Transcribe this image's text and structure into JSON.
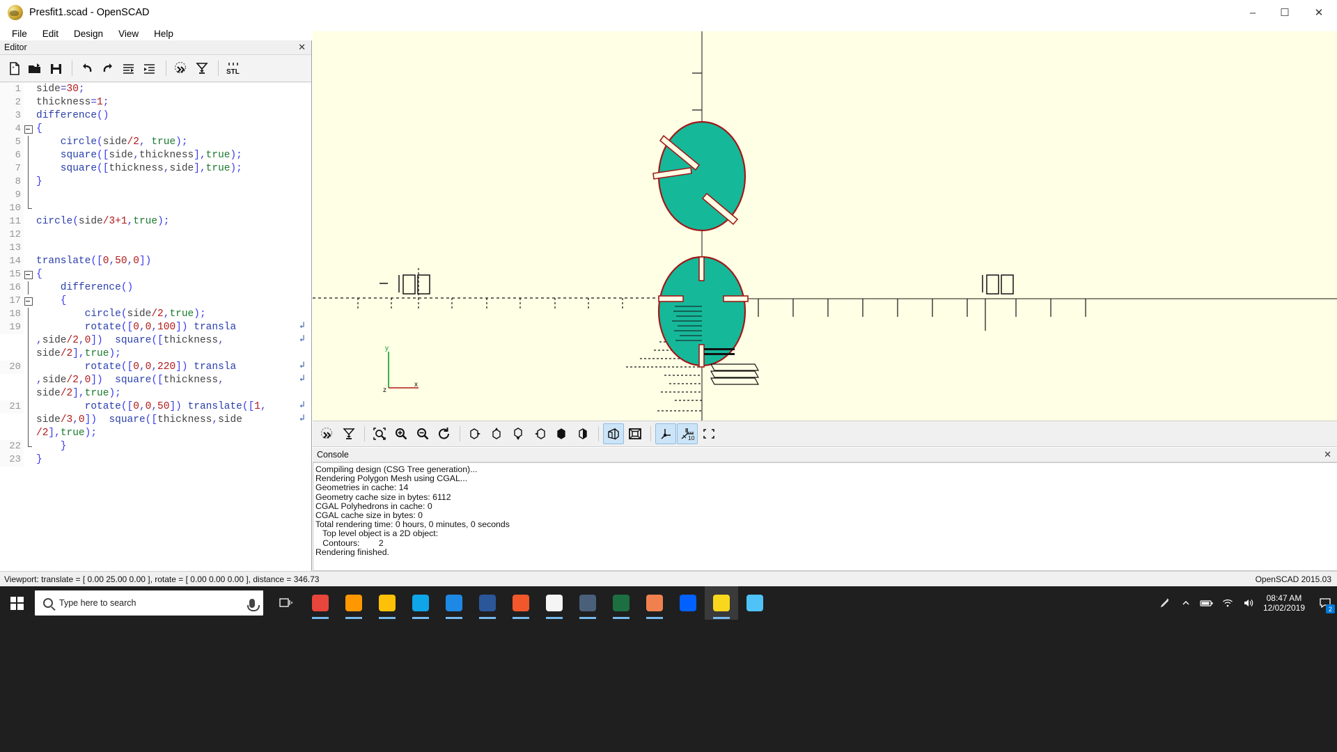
{
  "window": {
    "title": "Presfit1.scad - OpenSCAD",
    "app_icon": "openscad-logo-icon",
    "minimize": "–",
    "maximize": "☐",
    "close": "✕"
  },
  "menubar": {
    "items": [
      {
        "label": "File"
      },
      {
        "label": "Edit"
      },
      {
        "label": "Design"
      },
      {
        "label": "View"
      },
      {
        "label": "Help"
      }
    ]
  },
  "editor": {
    "dock_title": "Editor",
    "close_label": "✕",
    "toolbar": [
      {
        "name": "new-file-button",
        "tip": "New"
      },
      {
        "name": "open-file-button",
        "tip": "Open"
      },
      {
        "name": "save-file-button",
        "tip": "Save"
      },
      {
        "name": "undo-button",
        "tip": "Undo"
      },
      {
        "name": "redo-button",
        "tip": "Redo"
      },
      {
        "name": "unindent-button",
        "tip": "Unindent"
      },
      {
        "name": "indent-button",
        "tip": "Indent"
      },
      {
        "name": "preview-button",
        "tip": "Preview"
      },
      {
        "name": "render-button",
        "tip": "Render"
      },
      {
        "name": "export-stl-button",
        "tip": "Export as STL",
        "label": "STL"
      }
    ],
    "lines": [
      {
        "n": "1",
        "fold": "none",
        "segs": [
          {
            "t": "side",
            "c": "var"
          },
          {
            "t": "=",
            "c": "pun"
          },
          {
            "t": "30",
            "c": "num"
          },
          {
            "t": ";",
            "c": "pun"
          }
        ]
      },
      {
        "n": "2",
        "fold": "none",
        "segs": [
          {
            "t": "thickness",
            "c": "var"
          },
          {
            "t": "=",
            "c": "pun"
          },
          {
            "t": "1",
            "c": "num"
          },
          {
            "t": ";",
            "c": "pun"
          }
        ]
      },
      {
        "n": "3",
        "fold": "none",
        "segs": [
          {
            "t": "difference",
            "c": "kw"
          },
          {
            "t": "()",
            "c": "op"
          }
        ]
      },
      {
        "n": "4",
        "fold": "box",
        "segs": [
          {
            "t": "{",
            "c": "op"
          }
        ]
      },
      {
        "n": "5",
        "fold": "bar",
        "segs": [
          {
            "t": "    circle",
            "c": "kw"
          },
          {
            "t": "(",
            "c": "op"
          },
          {
            "t": "side",
            "c": "var"
          },
          {
            "t": "/",
            "c": "num"
          },
          {
            "t": "2",
            "c": "num"
          },
          {
            "t": ", ",
            "c": "pun"
          },
          {
            "t": "true",
            "c": "bool"
          },
          {
            "t": ");",
            "c": "op"
          }
        ]
      },
      {
        "n": "6",
        "fold": "bar",
        "segs": [
          {
            "t": "    square",
            "c": "kw"
          },
          {
            "t": "([",
            "c": "op"
          },
          {
            "t": "side",
            "c": "var"
          },
          {
            "t": ",",
            "c": "pun"
          },
          {
            "t": "thickness",
            "c": "var"
          },
          {
            "t": "],",
            "c": "op"
          },
          {
            "t": "true",
            "c": "bool"
          },
          {
            "t": ");",
            "c": "op"
          }
        ]
      },
      {
        "n": "7",
        "fold": "bar",
        "segs": [
          {
            "t": "    square",
            "c": "kw"
          },
          {
            "t": "([",
            "c": "op"
          },
          {
            "t": "thickness",
            "c": "var"
          },
          {
            "t": ",",
            "c": "pun"
          },
          {
            "t": "side",
            "c": "var"
          },
          {
            "t": "],",
            "c": "op"
          },
          {
            "t": "true",
            "c": "bool"
          },
          {
            "t": ");",
            "c": "op"
          }
        ]
      },
      {
        "n": "8",
        "fold": "bar",
        "segs": [
          {
            "t": "}",
            "c": "op"
          }
        ]
      },
      {
        "n": "9",
        "fold": "bar",
        "segs": []
      },
      {
        "n": "10",
        "fold": "endbar",
        "segs": []
      },
      {
        "n": "11",
        "fold": "none",
        "segs": [
          {
            "t": "circle",
            "c": "kw"
          },
          {
            "t": "(",
            "c": "op"
          },
          {
            "t": "side",
            "c": "var"
          },
          {
            "t": "/",
            "c": "num"
          },
          {
            "t": "3",
            "c": "num"
          },
          {
            "t": "+",
            "c": "num"
          },
          {
            "t": "1",
            "c": "num"
          },
          {
            "t": ",",
            "c": "pun"
          },
          {
            "t": "true",
            "c": "bool"
          },
          {
            "t": ");",
            "c": "op"
          }
        ]
      },
      {
        "n": "12",
        "fold": "none",
        "segs": []
      },
      {
        "n": "13",
        "fold": "none",
        "segs": []
      },
      {
        "n": "14",
        "fold": "none",
        "segs": [
          {
            "t": "translate",
            "c": "kw"
          },
          {
            "t": "([",
            "c": "op"
          },
          {
            "t": "0",
            "c": "num"
          },
          {
            "t": ",",
            "c": "pun"
          },
          {
            "t": "50",
            "c": "num"
          },
          {
            "t": ",",
            "c": "pun"
          },
          {
            "t": "0",
            "c": "num"
          },
          {
            "t": "])",
            "c": "op"
          }
        ]
      },
      {
        "n": "15",
        "fold": "box",
        "segs": [
          {
            "t": "{",
            "c": "op"
          }
        ]
      },
      {
        "n": "16",
        "fold": "bar",
        "segs": [
          {
            "t": "    difference",
            "c": "kw"
          },
          {
            "t": "()",
            "c": "op"
          }
        ]
      },
      {
        "n": "17",
        "fold": "box2",
        "segs": [
          {
            "t": "    {",
            "c": "op"
          }
        ]
      },
      {
        "n": "18",
        "fold": "bar",
        "segs": [
          {
            "t": "        circle",
            "c": "kw"
          },
          {
            "t": "(",
            "c": "op"
          },
          {
            "t": "side",
            "c": "var"
          },
          {
            "t": "/",
            "c": "num"
          },
          {
            "t": "2",
            "c": "num"
          },
          {
            "t": ",",
            "c": "pun"
          },
          {
            "t": "true",
            "c": "bool"
          },
          {
            "t": ");",
            "c": "op"
          }
        ]
      },
      {
        "n": "19",
        "fold": "bar",
        "wrap": true,
        "segs": [
          {
            "t": "        rotate",
            "c": "kw"
          },
          {
            "t": "([",
            "c": "op"
          },
          {
            "t": "0",
            "c": "num"
          },
          {
            "t": ",",
            "c": "pun"
          },
          {
            "t": "0",
            "c": "num"
          },
          {
            "t": ",",
            "c": "pun"
          },
          {
            "t": "100",
            "c": "num"
          },
          {
            "t": "]) ",
            "c": "op"
          },
          {
            "t": "transla",
            "c": "kw"
          }
        ]
      },
      {
        "n": "",
        "fold": "bar",
        "wrap": true,
        "segs": [
          {
            "t": ",",
            "c": "pun"
          },
          {
            "t": "side",
            "c": "var"
          },
          {
            "t": "/",
            "c": "num"
          },
          {
            "t": "2",
            "c": "num"
          },
          {
            "t": ",",
            "c": "pun"
          },
          {
            "t": "0",
            "c": "num"
          },
          {
            "t": "])  ",
            "c": "op"
          },
          {
            "t": "square",
            "c": "kw"
          },
          {
            "t": "([",
            "c": "op"
          },
          {
            "t": "thickness",
            "c": "var"
          },
          {
            "t": ",",
            "c": "pun"
          }
        ]
      },
      {
        "n": "",
        "fold": "bar",
        "segs": [
          {
            "t": "side",
            "c": "var"
          },
          {
            "t": "/",
            "c": "num"
          },
          {
            "t": "2",
            "c": "num"
          },
          {
            "t": "],",
            "c": "op"
          },
          {
            "t": "true",
            "c": "bool"
          },
          {
            "t": ");",
            "c": "op"
          }
        ]
      },
      {
        "n": "20",
        "fold": "bar",
        "wrap": true,
        "segs": [
          {
            "t": "        rotate",
            "c": "kw"
          },
          {
            "t": "([",
            "c": "op"
          },
          {
            "t": "0",
            "c": "num"
          },
          {
            "t": ",",
            "c": "pun"
          },
          {
            "t": "0",
            "c": "num"
          },
          {
            "t": ",",
            "c": "pun"
          },
          {
            "t": "220",
            "c": "num"
          },
          {
            "t": "]) ",
            "c": "op"
          },
          {
            "t": "transla",
            "c": "kw"
          }
        ]
      },
      {
        "n": "",
        "fold": "bar",
        "wrap": true,
        "segs": [
          {
            "t": ",",
            "c": "pun"
          },
          {
            "t": "side",
            "c": "var"
          },
          {
            "t": "/",
            "c": "num"
          },
          {
            "t": "2",
            "c": "num"
          },
          {
            "t": ",",
            "c": "pun"
          },
          {
            "t": "0",
            "c": "num"
          },
          {
            "t": "])  ",
            "c": "op"
          },
          {
            "t": "square",
            "c": "kw"
          },
          {
            "t": "([",
            "c": "op"
          },
          {
            "t": "thickness",
            "c": "var"
          },
          {
            "t": ",",
            "c": "pun"
          }
        ]
      },
      {
        "n": "",
        "fold": "bar",
        "segs": [
          {
            "t": "side",
            "c": "var"
          },
          {
            "t": "/",
            "c": "num"
          },
          {
            "t": "2",
            "c": "num"
          },
          {
            "t": "],",
            "c": "op"
          },
          {
            "t": "true",
            "c": "bool"
          },
          {
            "t": ");",
            "c": "op"
          }
        ]
      },
      {
        "n": "21",
        "fold": "bar",
        "wrap": true,
        "segs": [
          {
            "t": "        rotate",
            "c": "kw"
          },
          {
            "t": "([",
            "c": "op"
          },
          {
            "t": "0",
            "c": "num"
          },
          {
            "t": ",",
            "c": "pun"
          },
          {
            "t": "0",
            "c": "num"
          },
          {
            "t": ",",
            "c": "pun"
          },
          {
            "t": "50",
            "c": "num"
          },
          {
            "t": "]) ",
            "c": "op"
          },
          {
            "t": "translate",
            "c": "kw"
          },
          {
            "t": "([",
            "c": "op"
          },
          {
            "t": "1",
            "c": "num"
          },
          {
            "t": ",",
            "c": "pun"
          }
        ]
      },
      {
        "n": "",
        "fold": "bar",
        "wrap": true,
        "segs": [
          {
            "t": "side",
            "c": "var"
          },
          {
            "t": "/",
            "c": "num"
          },
          {
            "t": "3",
            "c": "num"
          },
          {
            "t": ",",
            "c": "pun"
          },
          {
            "t": "0",
            "c": "num"
          },
          {
            "t": "])  ",
            "c": "op"
          },
          {
            "t": "square",
            "c": "kw"
          },
          {
            "t": "([",
            "c": "op"
          },
          {
            "t": "thickness",
            "c": "var"
          },
          {
            "t": ",",
            "c": "pun"
          },
          {
            "t": "side",
            "c": "var"
          }
        ]
      },
      {
        "n": "",
        "fold": "bar",
        "segs": [
          {
            "t": "/",
            "c": "num"
          },
          {
            "t": "2",
            "c": "num"
          },
          {
            "t": "],",
            "c": "op"
          },
          {
            "t": "true",
            "c": "bool"
          },
          {
            "t": ");",
            "c": "op"
          }
        ]
      },
      {
        "n": "22",
        "fold": "endbar",
        "segs": [
          {
            "t": "    }",
            "c": "op"
          }
        ]
      },
      {
        "n": "23",
        "fold": "none",
        "segs": [
          {
            "t": "}",
            "c": "op"
          }
        ]
      }
    ],
    "wrap_glyph": "↲"
  },
  "viewport": {
    "background_color": "#ffffe5",
    "object_fill": "#16b89a",
    "object_stroke": "#a01818",
    "axis_color": "#000000",
    "x_axis_label": "x",
    "y_axis_label": "y",
    "z_axis_label": "z",
    "tick_label_left": "-100",
    "tick_label_right": "100",
    "scale_unit": "10"
  },
  "viewport_toolbar": {
    "buttons": [
      {
        "name": "preview-button",
        "active": false
      },
      {
        "name": "render-button",
        "active": false
      },
      {
        "name": "zoom-all-button",
        "active": false
      },
      {
        "name": "zoom-in-button",
        "active": false
      },
      {
        "name": "zoom-out-button",
        "active": false
      },
      {
        "name": "reset-view-button",
        "active": false
      },
      {
        "name": "view-right-button",
        "active": false
      },
      {
        "name": "view-top-button",
        "active": false
      },
      {
        "name": "view-bottom-button",
        "active": false
      },
      {
        "name": "view-left-button",
        "active": false
      },
      {
        "name": "view-front-button",
        "active": false
      },
      {
        "name": "view-back-button",
        "active": false
      },
      {
        "name": "perspective-view-button",
        "active": true
      },
      {
        "name": "orthogonal-view-button",
        "active": false
      },
      {
        "name": "show-axes-button",
        "active": true
      },
      {
        "name": "show-scale-markers-button",
        "active": true,
        "label": "10"
      },
      {
        "name": "show-crosshairs-button",
        "active": false
      }
    ]
  },
  "console": {
    "dock_title": "Console",
    "close_label": "✕",
    "lines": [
      "Compiling design (CSG Tree generation)...",
      "Rendering Polygon Mesh using CGAL...",
      "Geometries in cache: 14",
      "Geometry cache size in bytes: 6112",
      "CGAL Polyhedrons in cache: 0",
      "CGAL cache size in bytes: 0",
      "Total rendering time: 0 hours, 0 minutes, 0 seconds",
      "   Top level object is a 2D object:",
      "   Contours:        2",
      "Rendering finished."
    ]
  },
  "statusbar": {
    "viewport_info": "Viewport: translate = [ 0.00 25.00 0.00 ], rotate = [ 0.00 0.00 0.00 ], distance = 346.73",
    "version": "OpenSCAD 2015.03"
  },
  "taskbar": {
    "start_label": "windows-start",
    "search_placeholder": "Type here to search",
    "apps": [
      {
        "name": "taskview-icon"
      },
      {
        "name": "chrome-icon",
        "color": "#e8453c"
      },
      {
        "name": "sublime-text-icon",
        "color": "#ff9800"
      },
      {
        "name": "file-explorer-icon",
        "color": "#ffc107"
      },
      {
        "name": "edge-icon",
        "color": "#0ea5e9"
      },
      {
        "name": "onedrive-icon",
        "color": "#1e88e5"
      },
      {
        "name": "word-icon",
        "color": "#2b579a"
      },
      {
        "name": "settings-icon",
        "color": "#f0582c"
      },
      {
        "name": "store-icon",
        "color": "#f5f5f5"
      },
      {
        "name": "calculator-icon",
        "color": "#4a5f7a"
      },
      {
        "name": "excel-icon",
        "color": "#1d6f42"
      },
      {
        "name": "libreoffice-icon",
        "color": "#f0814f"
      },
      {
        "name": "dropbox-icon",
        "color": "#0061ff"
      },
      {
        "name": "openscad-icon",
        "color": "#f9d71c"
      },
      {
        "name": "app-icon",
        "color": "#4fc3f7"
      }
    ],
    "tray": {
      "pen_icon": "pen-icon",
      "chevron_icon": "show-hidden-icons-chevron",
      "battery_icon": "battery-icon",
      "wifi_icon": "wifi-icon",
      "volume_icon": "volume-icon",
      "time": "08:47 AM",
      "date": "12/02/2019",
      "notification_count": "2"
    }
  }
}
